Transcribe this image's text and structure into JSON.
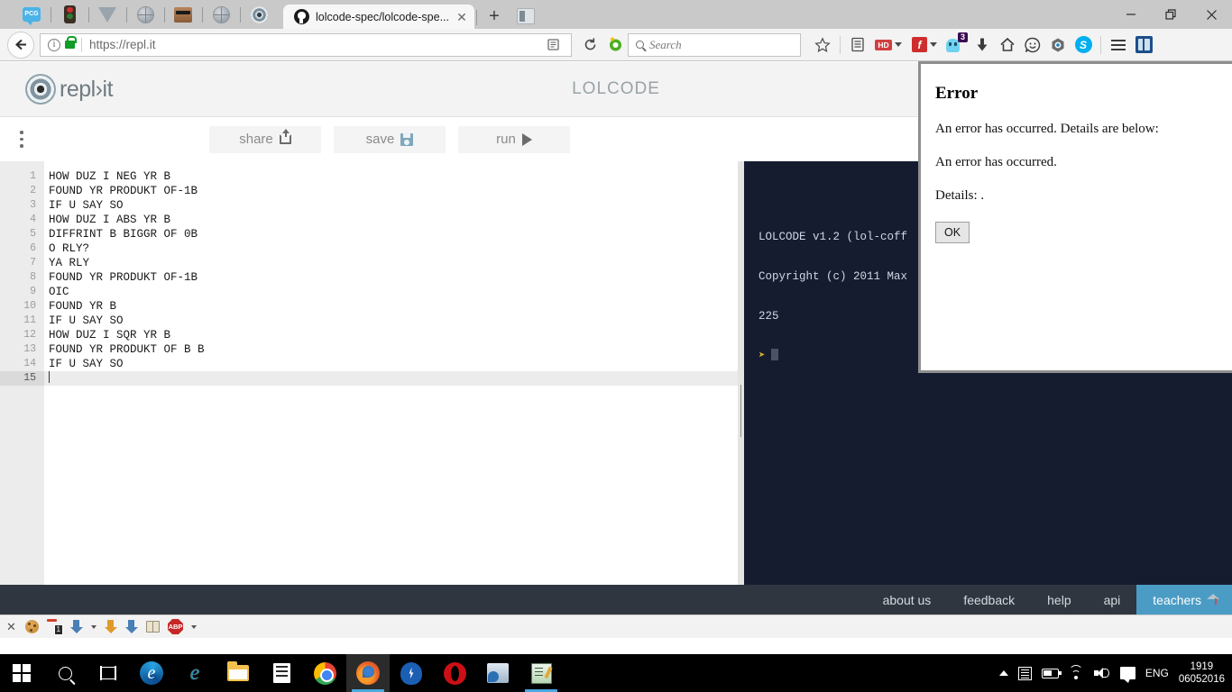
{
  "browser": {
    "pinned_tabs": [
      {
        "name": "pcg-tab",
        "icon": "pcg-chat-icon",
        "label": "PCG"
      },
      {
        "name": "traffic-light-tab",
        "icon": "traffic-light-icon",
        "label": ""
      },
      {
        "name": "triangle-tab",
        "icon": "triangle-icon",
        "label": ""
      },
      {
        "name": "globe-tab-1",
        "icon": "globe-icon",
        "label": ""
      },
      {
        "name": "face-tab",
        "icon": "face-icon",
        "label": ""
      },
      {
        "name": "globe-tab-2",
        "icon": "globe-icon",
        "label": ""
      },
      {
        "name": "spiral-tab",
        "icon": "spiral-icon",
        "label": ""
      }
    ],
    "active_tab": {
      "title": "lolcode-spec/lolcode-spe...",
      "favicon": "github-icon",
      "close_label": "✕"
    },
    "new_tab_label": "+",
    "window_controls": {
      "minimize": "minimize-icon",
      "restore": "restore-icon",
      "close": "close-icon"
    },
    "url": "https://repl.it",
    "search_placeholder": "Search",
    "toolbar_icons": [
      "bookmark-star-icon",
      "reader-icon",
      "hd-video-icon",
      "flash-icon",
      "ghostery-icon",
      "download-icon",
      "home-icon",
      "smiley-icon",
      "hexagon-icon",
      "skype-icon",
      "menu-hamburger-icon",
      "panel-icon"
    ],
    "ghostery_badge": "3",
    "addon_bar": {
      "close_label": "✕",
      "badge": "1",
      "abp_label": "ABP"
    }
  },
  "repl": {
    "logo_text": "repl›it",
    "title": "LOLCODE",
    "toolbar": {
      "share_label": "share",
      "save_label": "save",
      "run_label": "run",
      "menu_icon": "vertical-dots-icon"
    },
    "editor": {
      "lines": [
        "HOW DUZ I NEG YR B",
        "FOUND YR PRODUKT OF-1B",
        "IF U SAY SO",
        "HOW DUZ I ABS YR B",
        "DIFFRINT B BIGGR OF 0B",
        "O RLY?",
        "YA RLY",
        "FOUND YR PRODUKT OF-1B",
        "OIC",
        "FOUND YR B",
        "IF U SAY SO",
        "HOW DUZ I SQR YR B",
        "FOUND YR PRODUKT OF B B",
        "IF U SAY SO",
        ""
      ],
      "active_line": 15,
      "line_numbers": [
        "1",
        "2",
        "3",
        "4",
        "5",
        "6",
        "7",
        "8",
        "9",
        "10",
        "11",
        "12",
        "13",
        "14",
        "15"
      ]
    },
    "console": {
      "lines": [
        "LOLCODE v1.2 (lol-coff",
        "Copyright (c) 2011 Max",
        "225"
      ],
      "prompt": "➤"
    },
    "footer": {
      "links": [
        {
          "label": "about us",
          "highlight": false
        },
        {
          "label": "feedback",
          "highlight": false
        },
        {
          "label": "help",
          "highlight": false
        },
        {
          "label": "api",
          "highlight": false
        },
        {
          "label": "teachers",
          "highlight": true
        }
      ]
    }
  },
  "dialog": {
    "title": "Error",
    "line1": "An error has occurred. Details are below:",
    "line2": "An error has occurred.",
    "line3": "Details: .",
    "ok_label": "OK"
  },
  "taskbar": {
    "items": [
      {
        "name": "start-button",
        "icon": "windows-logo-icon"
      },
      {
        "name": "search-button",
        "icon": "search-icon"
      },
      {
        "name": "task-view-button",
        "icon": "task-view-icon"
      },
      {
        "name": "edge-app",
        "icon": "edge-icon"
      },
      {
        "name": "internet-explorer-app",
        "icon": "ie-icon"
      },
      {
        "name": "file-explorer-app",
        "icon": "folder-icon"
      },
      {
        "name": "store-app",
        "icon": "store-icon"
      },
      {
        "name": "chrome-app",
        "icon": "chrome-icon"
      },
      {
        "name": "firefox-app",
        "icon": "firefox-icon"
      },
      {
        "name": "shield-app",
        "icon": "shield-icon"
      },
      {
        "name": "opera-app",
        "icon": "opera-icon"
      },
      {
        "name": "app-1",
        "icon": "app-icon"
      },
      {
        "name": "app-2",
        "icon": "editor-app-icon"
      }
    ],
    "tray": {
      "language": "ENG",
      "time": "1919",
      "date": "06052016"
    }
  }
}
